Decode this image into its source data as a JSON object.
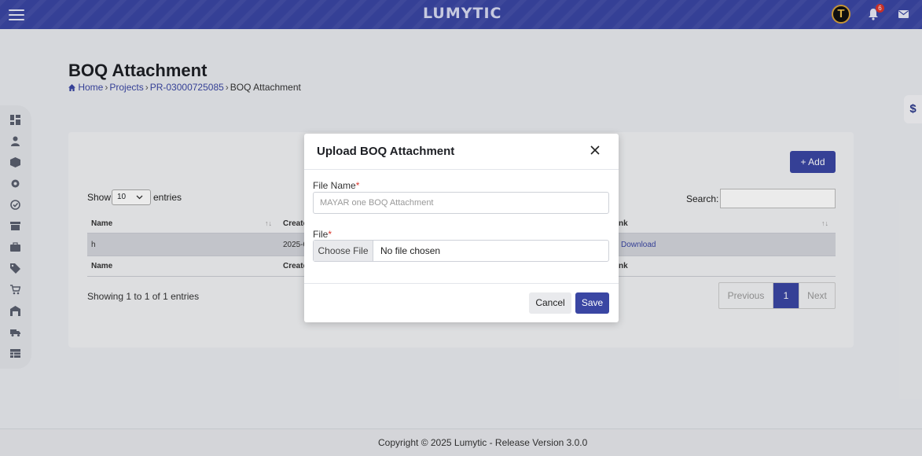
{
  "header": {
    "logo_text": "LUMYTIC",
    "avatar_letter": "T",
    "notification_count": "6"
  },
  "page": {
    "title": "BOQ Attachment",
    "breadcrumb": {
      "home": "Home",
      "projects": "Projects",
      "project_code": "PR-03000725085",
      "current": "BOQ Attachment"
    }
  },
  "currency_tab": "$",
  "table_controls": {
    "add_label": "+ Add",
    "show_label": "Show",
    "page_length": "10",
    "entries_label": "entries",
    "search_label": "Search:"
  },
  "table": {
    "columns": [
      "Name",
      "Create",
      "nk"
    ],
    "rows": [
      {
        "name": "h",
        "created": "2025-0",
        "link": "Download"
      }
    ],
    "footer_columns": [
      "Name",
      "Create",
      "nk"
    ],
    "info": "Showing 1 to 1 of 1 entries",
    "pagination": {
      "previous": "Previous",
      "page": "1",
      "next": "Next"
    }
  },
  "modal": {
    "title": "Upload BOQ Attachment",
    "file_name_label": "File Name",
    "file_name_placeholder": "MAYAR one BOQ Attachment",
    "file_label": "File",
    "required_mark": "*",
    "choose_file_label": "Choose File",
    "no_file_text": "No file chosen",
    "cancel_label": "Cancel",
    "save_label": "Save"
  },
  "footer": {
    "copyright": "Copyright © 2025 Lumytic - Release Version 3.0.0"
  },
  "colors": {
    "primary": "#3a46a3",
    "background": "#e9ebef",
    "required": "#d9342b"
  }
}
